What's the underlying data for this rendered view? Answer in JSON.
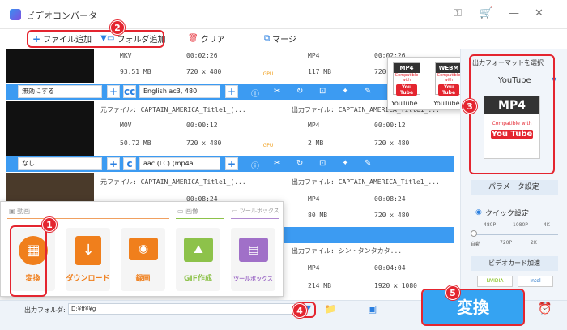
{
  "window": {
    "title": "ビデオコンバータ"
  },
  "toolbar": {
    "add_file": "ファイル追加",
    "add_folder": "フォルダ追加",
    "clear": "クリア",
    "merge": "マージ"
  },
  "files": [
    {
      "src_name": "",
      "src_format": "MKV",
      "src_duration": "00:02:26",
      "src_size": "93.51 MB",
      "src_res": "720 x 480",
      "out_name": "",
      "out_format": "MP4",
      "out_duration": "00:02:26",
      "out_size": "117 MB",
      "out_res": "720 x 480",
      "subtitle": "無効にする",
      "audio": "English ac3, 480"
    },
    {
      "src_name": "元ファイル: CAPTAIN_AMERICA_Title1_(...",
      "src_format": "MOV",
      "src_duration": "00:00:12",
      "src_size": "50.72 MB",
      "src_res": "720 x 480",
      "out_name": "出力ファイル: CAPTAIN_AMERICA_Title1_...",
      "out_format": "MP4",
      "out_duration": "00:00:12",
      "out_size": "2 MB",
      "out_res": "720 x 480",
      "subtitle": "なし",
      "audio": "aac (LC) (mp4a ..."
    },
    {
      "src_name": "元ファイル: CAPTAIN_AMERICA_Title1_(...",
      "src_duration": "00:08:24",
      "out_name": "出力ファイル: CAPTAIN_AMERICA_Title1_...",
      "out_format": "MP4",
      "out_duration": "00:08:24",
      "out_size": "80 MB",
      "out_res": "720 x 480"
    },
    {
      "out_name": "出力ファイル: シン・タンタカタ...",
      "out_format": "MP4",
      "out_duration": "00:04:04",
      "out_size": "214 MB",
      "out_res": "1920 x 1080"
    }
  ],
  "gpu_label": "GPU",
  "format_popup": {
    "items": [
      {
        "badge": "MP4",
        "label": "YouTube"
      },
      {
        "badge": "WEBM",
        "label": "YouTube"
      }
    ],
    "compatible": "Compatible with",
    "yt": "You Tube"
  },
  "right_panel": {
    "select_format": "出力フォーマットを選択",
    "platform": "YouTube",
    "format_badge": "MP4",
    "compatible": "Compatible with",
    "yt": "You Tube",
    "param_settings": "パラメータ設定",
    "quick_settings": "クイック設定",
    "scale_top": [
      "480P",
      "1080P",
      "4K"
    ],
    "scale_bottom": [
      "自動",
      "720P",
      "2K"
    ],
    "gpu_accel": "ビデオカード加速",
    "nvidia": "NVIDIA",
    "intel": "Intel"
  },
  "menu": {
    "sections": [
      "動画",
      "画像",
      "ツールボックス"
    ],
    "tiles": [
      "変換",
      "ダウンロード",
      "録画",
      "GIF作成",
      "ツールボックス"
    ]
  },
  "bottom": {
    "output_label": "出力フォルダ:",
    "output_path": "D:¥ff¥¥g",
    "convert": "変換"
  },
  "badges": [
    "1",
    "2",
    "3",
    "4",
    "5"
  ],
  "colors": {
    "accent": "#3c9bf2",
    "highlight": "#e4252f",
    "orange": "#f07f1c"
  }
}
